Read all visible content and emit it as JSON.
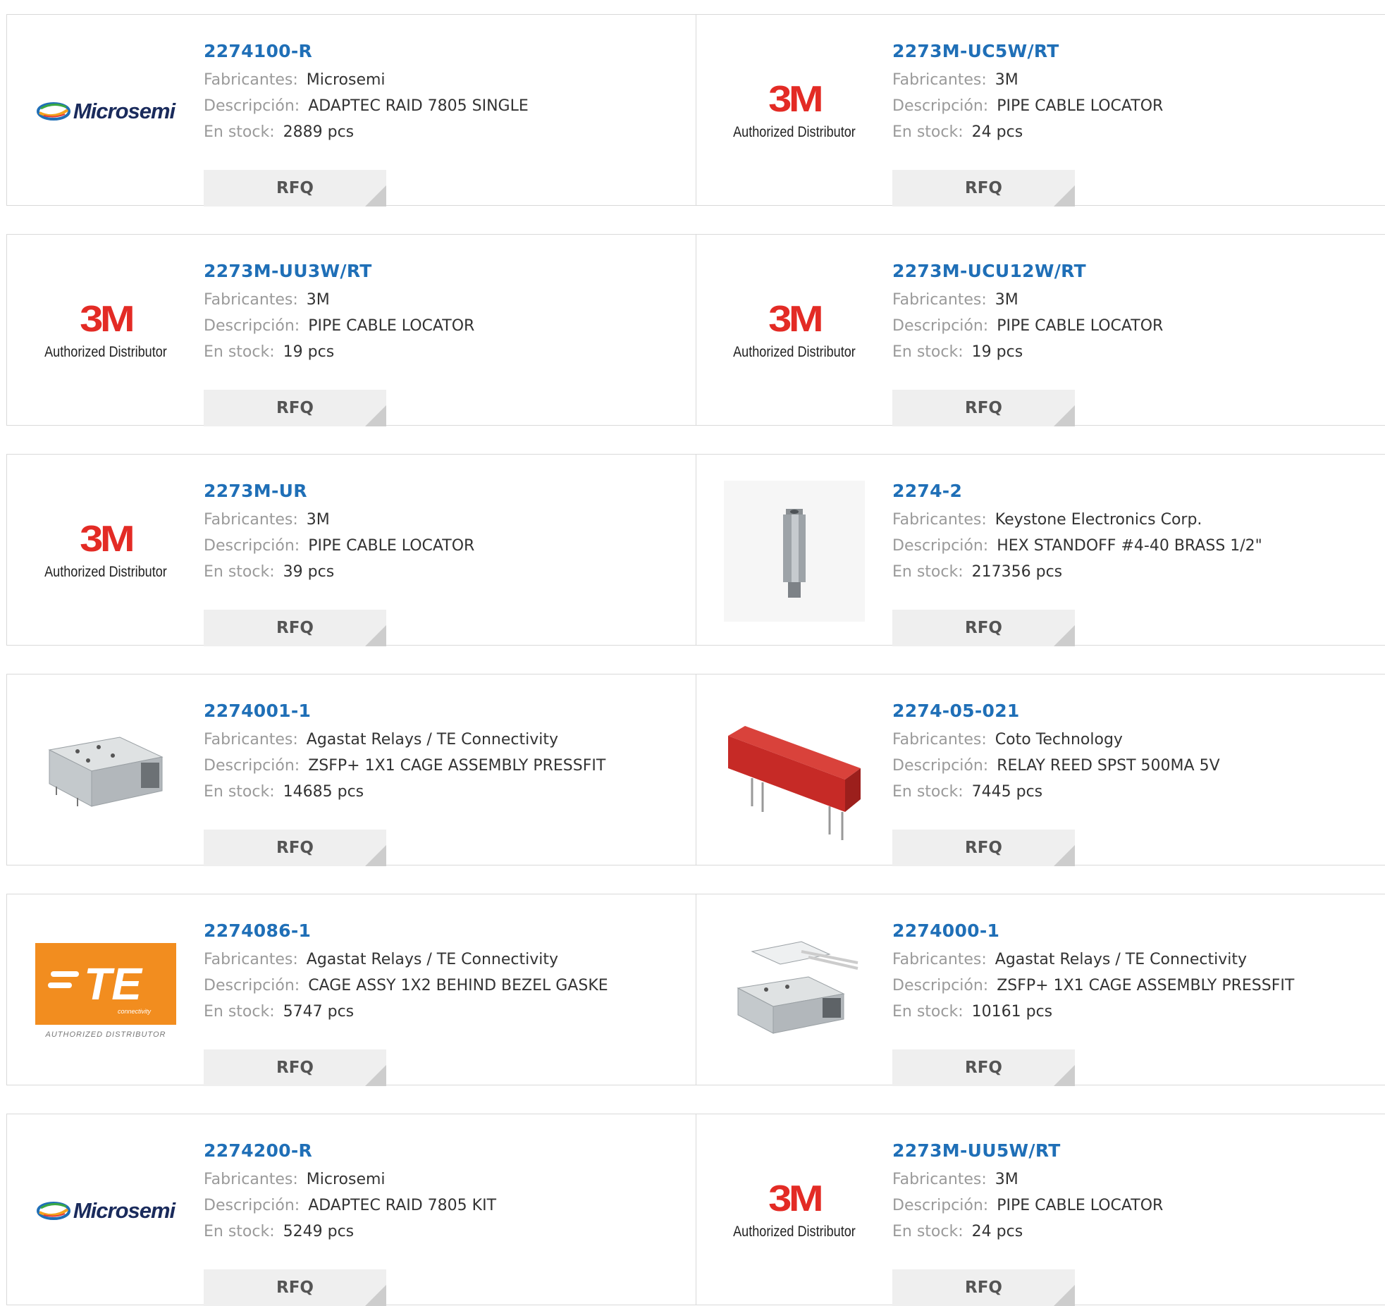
{
  "labels": {
    "manufacturer": "Fabricantes:",
    "description": "Descripción:",
    "stock": "En stock:",
    "rfq": "RFQ"
  },
  "logos": {
    "three_m_mark": "3M",
    "three_m_sub": "Authorized Distributor",
    "microsemi_text": "Microsemi",
    "te_text": "TE",
    "te_connectivity": "connectivity",
    "te_sub": "AUTHORIZED DISTRIBUTOR"
  },
  "products": [
    {
      "part": "2274100-R",
      "manufacturer": "Microsemi",
      "description": "ADAPTEC RAID 7805 SINGLE",
      "stock": "2889 pcs",
      "logo": "microsemi-logo"
    },
    {
      "part": "2273M-UC5W/RT",
      "manufacturer": "3M",
      "description": "PIPE CABLE LOCATOR",
      "stock": "24 pcs",
      "logo": "3m-logo"
    },
    {
      "part": "2273M-UU3W/RT",
      "manufacturer": "3M",
      "description": "PIPE CABLE LOCATOR",
      "stock": "19 pcs",
      "logo": "3m-logo"
    },
    {
      "part": "2273M-UCU12W/RT",
      "manufacturer": "3M",
      "description": "PIPE CABLE LOCATOR",
      "stock": "19 pcs",
      "logo": "3m-logo"
    },
    {
      "part": "2273M-UR",
      "manufacturer": "3M",
      "description": "PIPE CABLE LOCATOR",
      "stock": "39 pcs",
      "logo": "3m-logo"
    },
    {
      "part": "2274-2",
      "manufacturer": "Keystone Electronics Corp.",
      "description": "HEX STANDOFF #4-40 BRASS 1/2\"",
      "stock": "217356 pcs",
      "logo": "hex-standoff-photo"
    },
    {
      "part": "2274001-1",
      "manufacturer": "Agastat Relays / TE Connectivity",
      "description": "ZSFP+ 1X1 CAGE ASSEMBLY PRESSFIT",
      "stock": "14685 pcs",
      "logo": "cage-assembly-photo"
    },
    {
      "part": "2274-05-021",
      "manufacturer": "Coto Technology",
      "description": "RELAY REED SPST 500MA 5V",
      "stock": "7445 pcs",
      "logo": "reed-relay-photo"
    },
    {
      "part": "2274086-1",
      "manufacturer": "Agastat Relays / TE Connectivity",
      "description": "CAGE ASSY 1X2 BEHIND BEZEL GASKE",
      "stock": "5747 pcs",
      "logo": "te-logo"
    },
    {
      "part": "2274000-1",
      "manufacturer": "Agastat Relays / TE Connectivity",
      "description": "ZSFP+ 1X1 CAGE ASSEMBLY PRESSFIT",
      "stock": "10161 pcs",
      "logo": "cage-assembly-exploded-photo"
    },
    {
      "part": "2274200-R",
      "manufacturer": "Microsemi",
      "description": "ADAPTEC RAID 7805 KIT",
      "stock": "5249 pcs",
      "logo": "microsemi-logo"
    },
    {
      "part": "2273M-UU5W/RT",
      "manufacturer": "3M",
      "description": "PIPE CABLE LOCATOR",
      "stock": "24 pcs",
      "logo": "3m-logo"
    }
  ],
  "colors": {
    "part_link": "#1f6fb7",
    "label_gray": "#9a9a9a",
    "rfq_bg": "#efefef",
    "three_m_red": "#e32b25",
    "te_orange": "#f28d1f",
    "relay_red": "#c62a26"
  }
}
